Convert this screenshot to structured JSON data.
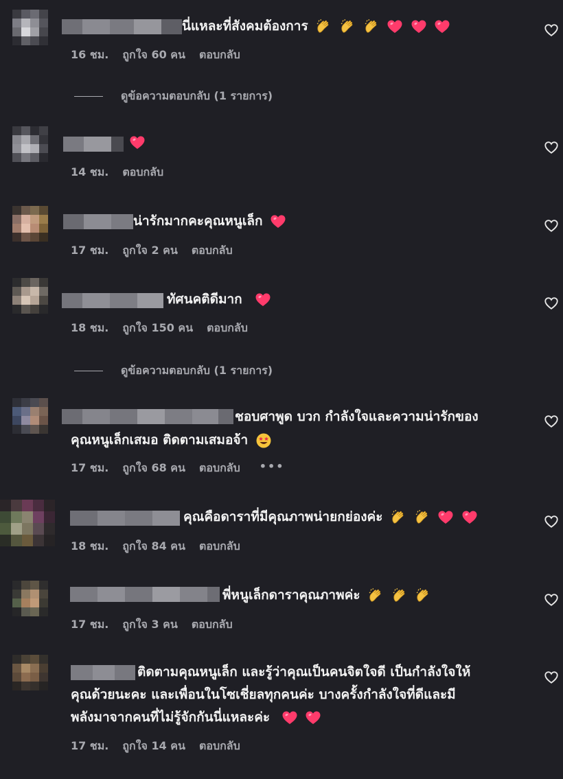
{
  "comments": [
    {
      "text": "นี่แหละที่สังคมต้องการ",
      "time": "16 ชม.",
      "likes": "ถูกใจ 60 คน",
      "reply": "ตอบกลับ"
    },
    {
      "text": "",
      "time": "14 ชม.",
      "likes": "",
      "reply": "ตอบกลับ"
    },
    {
      "text": "น่ารักมากคะคุณหนูเล็ก",
      "time": "17 ชม.",
      "likes": "ถูกใจ 2 คน",
      "reply": "ตอบกลับ"
    },
    {
      "text": "ทัศนคติดีมาก",
      "time": "18 ชม.",
      "likes": "ถูกใจ 150 คน",
      "reply": "ตอบกลับ"
    },
    {
      "text_line1": "ชอบศาพูด บวก กำลังใจและความน่ารักของ",
      "text_line2": "คุณหนูเล็กเสมอ ติดตามเสมอจ้า",
      "time": "17 ชม.",
      "likes": "ถูกใจ 68 คน",
      "reply": "ตอบกลับ",
      "more": "•••"
    },
    {
      "text": "คุณคือดาราที่มีคุณภาพน่ายกย่องค่ะ",
      "time": "18 ชม.",
      "likes": "ถูกใจ 84 คน",
      "reply": "ตอบกลับ"
    },
    {
      "text": "พี่หนูเล็กดาราคุณภาพค่ะ",
      "time": "17 ชม.",
      "likes": "ถูกใจ 3 คน",
      "reply": "ตอบกลับ"
    },
    {
      "text_line1": "ติดตามคุณหนูเล็ก และรู้ว่าคุณเป็นคนจิตใจดี เป็นกำลังใจให้",
      "text_line2": "คุณด้วยนะคะ และเพื่อนในโซเชี่ยลทุกคนค่ะ บางครั้งกำลังใจที่ดีและมี",
      "text_line3": "พลังมาจากคนที่ไม่รู้จักกันนี่แหละค่ะ",
      "time": "17 ชม.",
      "likes": "ถูกใจ 14 คน",
      "reply": "ตอบกลับ"
    }
  ],
  "view_replies": [
    "ดูข้อความตอบกลับ (1 รายการ)",
    "ดูข้อความตอบกลับ (1 รายการ)"
  ],
  "colors": {
    "background": "#1f1f25",
    "text": "#f2f2f2",
    "muted": "#a9aab0",
    "heart": "#ff3b6b",
    "clap": "#f5c242"
  },
  "icons": {
    "like": "heart-outline-icon",
    "emoji_heart": "pink-heart-emoji",
    "emoji_clap": "clapping-hands-emoji",
    "emoji_star_eyes": "star-struck-emoji"
  }
}
